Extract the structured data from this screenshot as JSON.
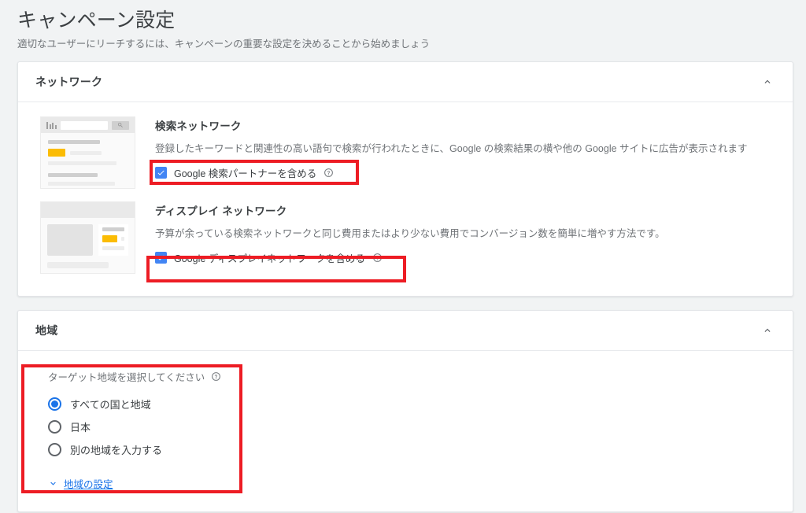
{
  "header": {
    "title": "キャンペーン設定",
    "subtitle": "適切なユーザーにリーチするには、キャンペーンの重要な設定を決めることから始めましょう"
  },
  "network_card": {
    "title": "ネットワーク",
    "collapse_icon": "chevron-up-icon",
    "search_network": {
      "title": "検索ネットワーク",
      "description": "登録したキーワードと関連性の高い語句で検索が行われたときに、Google の検索結果の横や他の Google サイトに広告が表示されます",
      "checkbox_label": "Google 検索パートナーを含める",
      "checkbox_checked": true,
      "help_icon": "help-circle-icon",
      "thumbnail": "search-results-mock"
    },
    "display_network": {
      "title": "ディスプレイ ネットワーク",
      "description": "予算が余っている検索ネットワークと同じ費用またはより少ない費用でコンバージョン数を簡単に増やす方法です。",
      "checkbox_label": "Google ディスプレイネットワークを含める",
      "checkbox_checked": true,
      "help_icon": "help-circle-icon",
      "thumbnail": "display-ad-mock"
    }
  },
  "location_card": {
    "title": "地域",
    "collapse_icon": "chevron-up-icon",
    "target_label": "ターゲット地域を選択してください",
    "help_icon": "help-circle-icon",
    "options": [
      {
        "label": "すべての国と地域",
        "selected": true
      },
      {
        "label": "日本",
        "selected": false
      },
      {
        "label": "別の地域を入力する",
        "selected": false
      }
    ],
    "settings_link": "地域の設定",
    "settings_link_icon": "chevron-down-icon"
  },
  "annotations": {
    "color": "#ed1c24",
    "boxes": [
      "search-partners-checkbox",
      "display-network-checkbox",
      "location-targeting-group"
    ]
  },
  "colors": {
    "page_background": "#f1f3f4",
    "card_background": "#ffffff",
    "checkbox_blue": "#4285f4",
    "radio_blue": "#1a73e8",
    "link_blue": "#1a73e8",
    "ad_badge_yellow": "#fbbc04",
    "annotation_red": "#ed1c24"
  }
}
